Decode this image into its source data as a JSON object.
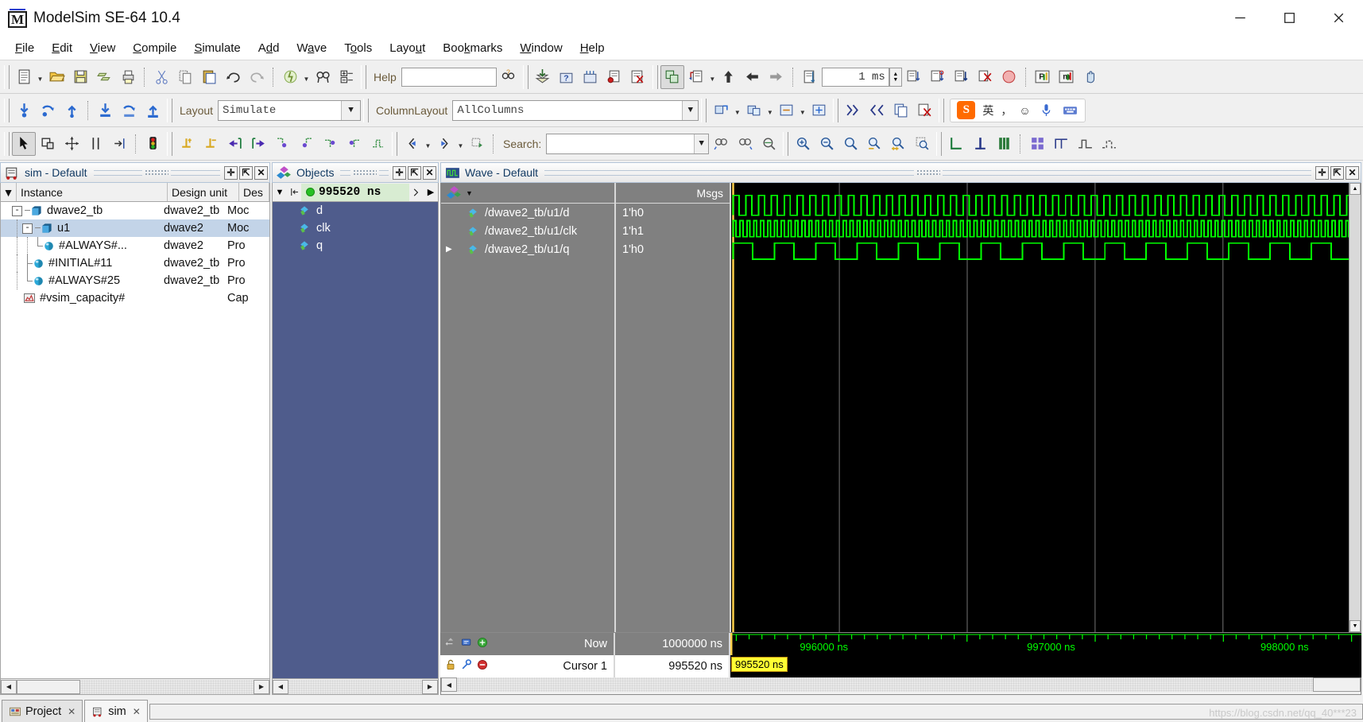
{
  "window": {
    "title": "ModelSim SE-64 10.4",
    "minimize": "—",
    "maximize": "☐",
    "close": "✕"
  },
  "menubar": {
    "items": [
      {
        "label": "File",
        "accel": "F"
      },
      {
        "label": "Edit",
        "accel": "E"
      },
      {
        "label": "View",
        "accel": "V"
      },
      {
        "label": "Compile",
        "accel": "C"
      },
      {
        "label": "Simulate",
        "accel": "S"
      },
      {
        "label": "Add",
        "accel": "d"
      },
      {
        "label": "Wave",
        "accel": "a"
      },
      {
        "label": "Tools",
        "accel": "o"
      },
      {
        "label": "Layout",
        "accel": "u"
      },
      {
        "label": "Bookmarks",
        "accel": "k"
      },
      {
        "label": "Window",
        "accel": "W"
      },
      {
        "label": "Help",
        "accel": "H"
      }
    ]
  },
  "toolbar1": {
    "help_label": "Help",
    "help_value": "",
    "help_placeholder": "",
    "run_length_value": "1 ms"
  },
  "toolbar2": {
    "layout_label": "Layout",
    "layout_value": "Simulate",
    "columnlayout_label": "ColumnLayout",
    "columnlayout_value": "AllColumns"
  },
  "toolbar3": {
    "search_label": "Search:",
    "search_value": "",
    "search_placeholder": ""
  },
  "sim_pane": {
    "title": "sim - Default",
    "columns": [
      "Instance",
      "Design unit",
      "Des"
    ],
    "rows": [
      {
        "instance": "dwave2_tb",
        "design_unit": "dwave2_tb",
        "design_type": "Moc",
        "depth": 0,
        "expander": "-",
        "icon": "module-icon",
        "selected": false
      },
      {
        "instance": "u1",
        "design_unit": "dwave2",
        "design_type": "Moc",
        "depth": 1,
        "expander": "-",
        "icon": "module-icon",
        "selected": true
      },
      {
        "instance": "#ALWAYS#...",
        "design_unit": "dwave2",
        "design_type": "Pro",
        "depth": 2,
        "expander": "",
        "icon": "process-icon",
        "selected": false
      },
      {
        "instance": "#INITIAL#11",
        "design_unit": "dwave2_tb",
        "design_type": "Pro",
        "depth": 1,
        "expander": "",
        "icon": "process-icon",
        "selected": false
      },
      {
        "instance": "#ALWAYS#25",
        "design_unit": "dwave2_tb",
        "design_type": "Pro",
        "depth": 1,
        "expander": "",
        "icon": "process-icon",
        "selected": false
      },
      {
        "instance": "#vsim_capacity#",
        "design_unit": "",
        "design_type": "Cap",
        "depth": 0,
        "expander": "",
        "icon": "capacity-icon",
        "selected": false
      }
    ]
  },
  "objects_pane": {
    "title": "Objects",
    "time": "995520 ns",
    "rows": [
      {
        "name": "d"
      },
      {
        "name": "clk"
      },
      {
        "name": "q"
      }
    ]
  },
  "wave_pane": {
    "title": "Wave - Default",
    "msgs_header": "Msgs",
    "signals": [
      {
        "name": "/dwave2_tb/u1/d",
        "value": "1'h0"
      },
      {
        "name": "/dwave2_tb/u1/clk",
        "value": "1'h1"
      },
      {
        "name": "/dwave2_tb/u1/q",
        "value": "1'h0"
      }
    ],
    "footer": {
      "now_label": "Now",
      "now_value": "1000000 ns",
      "cursor_label": "Cursor 1",
      "cursor_value": "995520 ns"
    },
    "ruler": {
      "ticks": [
        "996000 ns",
        "997000 ns",
        "998000 ns"
      ],
      "cursor_tag": "995520 ns"
    },
    "colors": {
      "signal": "#00ff00",
      "background": "#000000",
      "cursor": "#ffd24d",
      "grid": "#6b6b6b"
    }
  },
  "bottom_tabs": {
    "tabs": [
      {
        "label": "Project",
        "icon": "project-icon",
        "active": false,
        "closable": true
      },
      {
        "label": "sim",
        "icon": "sim-icon",
        "active": true,
        "closable": true
      }
    ]
  },
  "watermark": "https://blog.csdn.net/qq_40***23",
  "ime": {
    "logo": "S",
    "mode": "英",
    "items": [
      "comma-icon",
      "smiley-icon",
      "mic-icon",
      "keyboard-icon"
    ]
  }
}
